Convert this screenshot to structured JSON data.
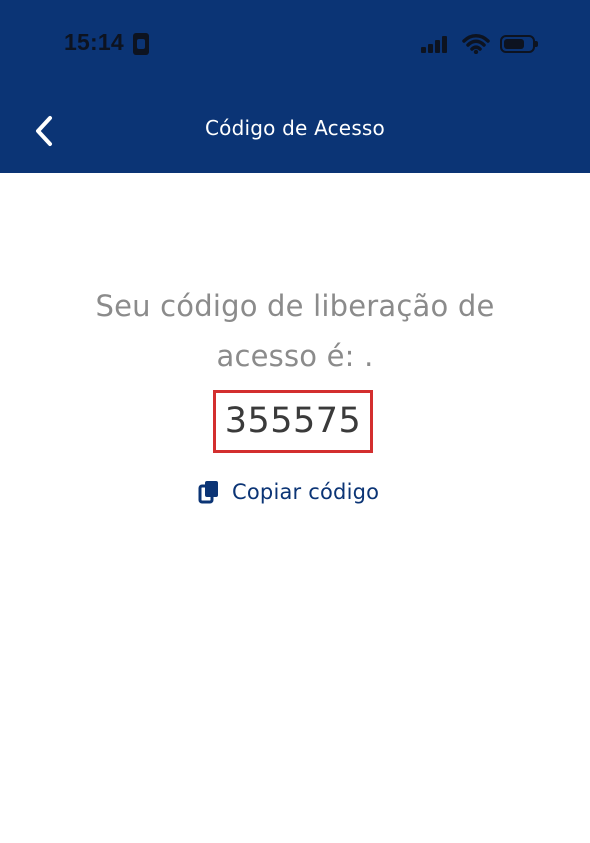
{
  "status_bar": {
    "time": "15:14",
    "icons": [
      "signal-icon",
      "wifi-icon",
      "battery-icon"
    ]
  },
  "header": {
    "title": "Código de Acesso",
    "back_icon": "chevron-left-icon",
    "background_color": "#0b3475"
  },
  "content": {
    "message": "Seu código de liberação de acesso é: .",
    "code": "355575",
    "copy_label": "Copiar código",
    "copy_icon": "copy-icon",
    "highlight_color": "#d32f2f"
  }
}
